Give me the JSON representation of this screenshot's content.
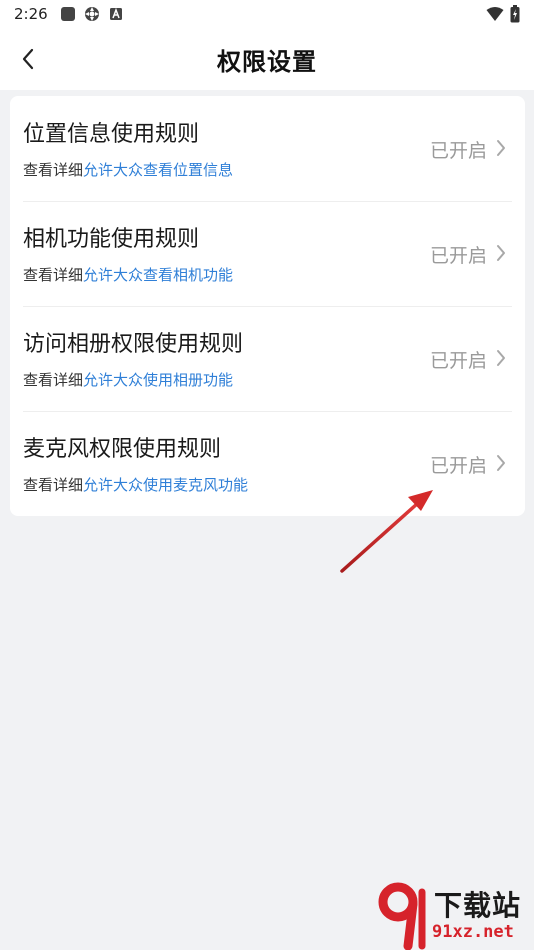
{
  "status_bar": {
    "time": "2:26",
    "icons_left": [
      "square-app-icon",
      "gear-app-icon",
      "a-app-icon"
    ],
    "icons_right": [
      "wifi-icon",
      "battery-icon"
    ]
  },
  "header": {
    "title": "权限设置",
    "back_icon": "chevron-left-icon"
  },
  "permissions": [
    {
      "title": "位置信息使用规则",
      "detail_prefix": "查看详细",
      "detail_link": "允许大众查看位置信息",
      "status": "已开启"
    },
    {
      "title": "相机功能使用规则",
      "detail_prefix": "查看详细",
      "detail_link": "允许大众查看相机功能",
      "status": "已开启"
    },
    {
      "title": "访问相册权限使用规则",
      "detail_prefix": "查看详细",
      "detail_link": "允许大众使用相册功能",
      "status": "已开启"
    },
    {
      "title": "麦克风权限使用规则",
      "detail_prefix": "查看详细",
      "detail_link": "允许大众使用麦克风功能",
      "status": "已开启"
    }
  ],
  "watermark": {
    "line1": "下载站",
    "line2": "91xz.net"
  },
  "colors": {
    "link": "#2f7fd7",
    "status": "#9a9a9a",
    "background": "#f1f2f4",
    "arrow": "#d42a2a"
  }
}
